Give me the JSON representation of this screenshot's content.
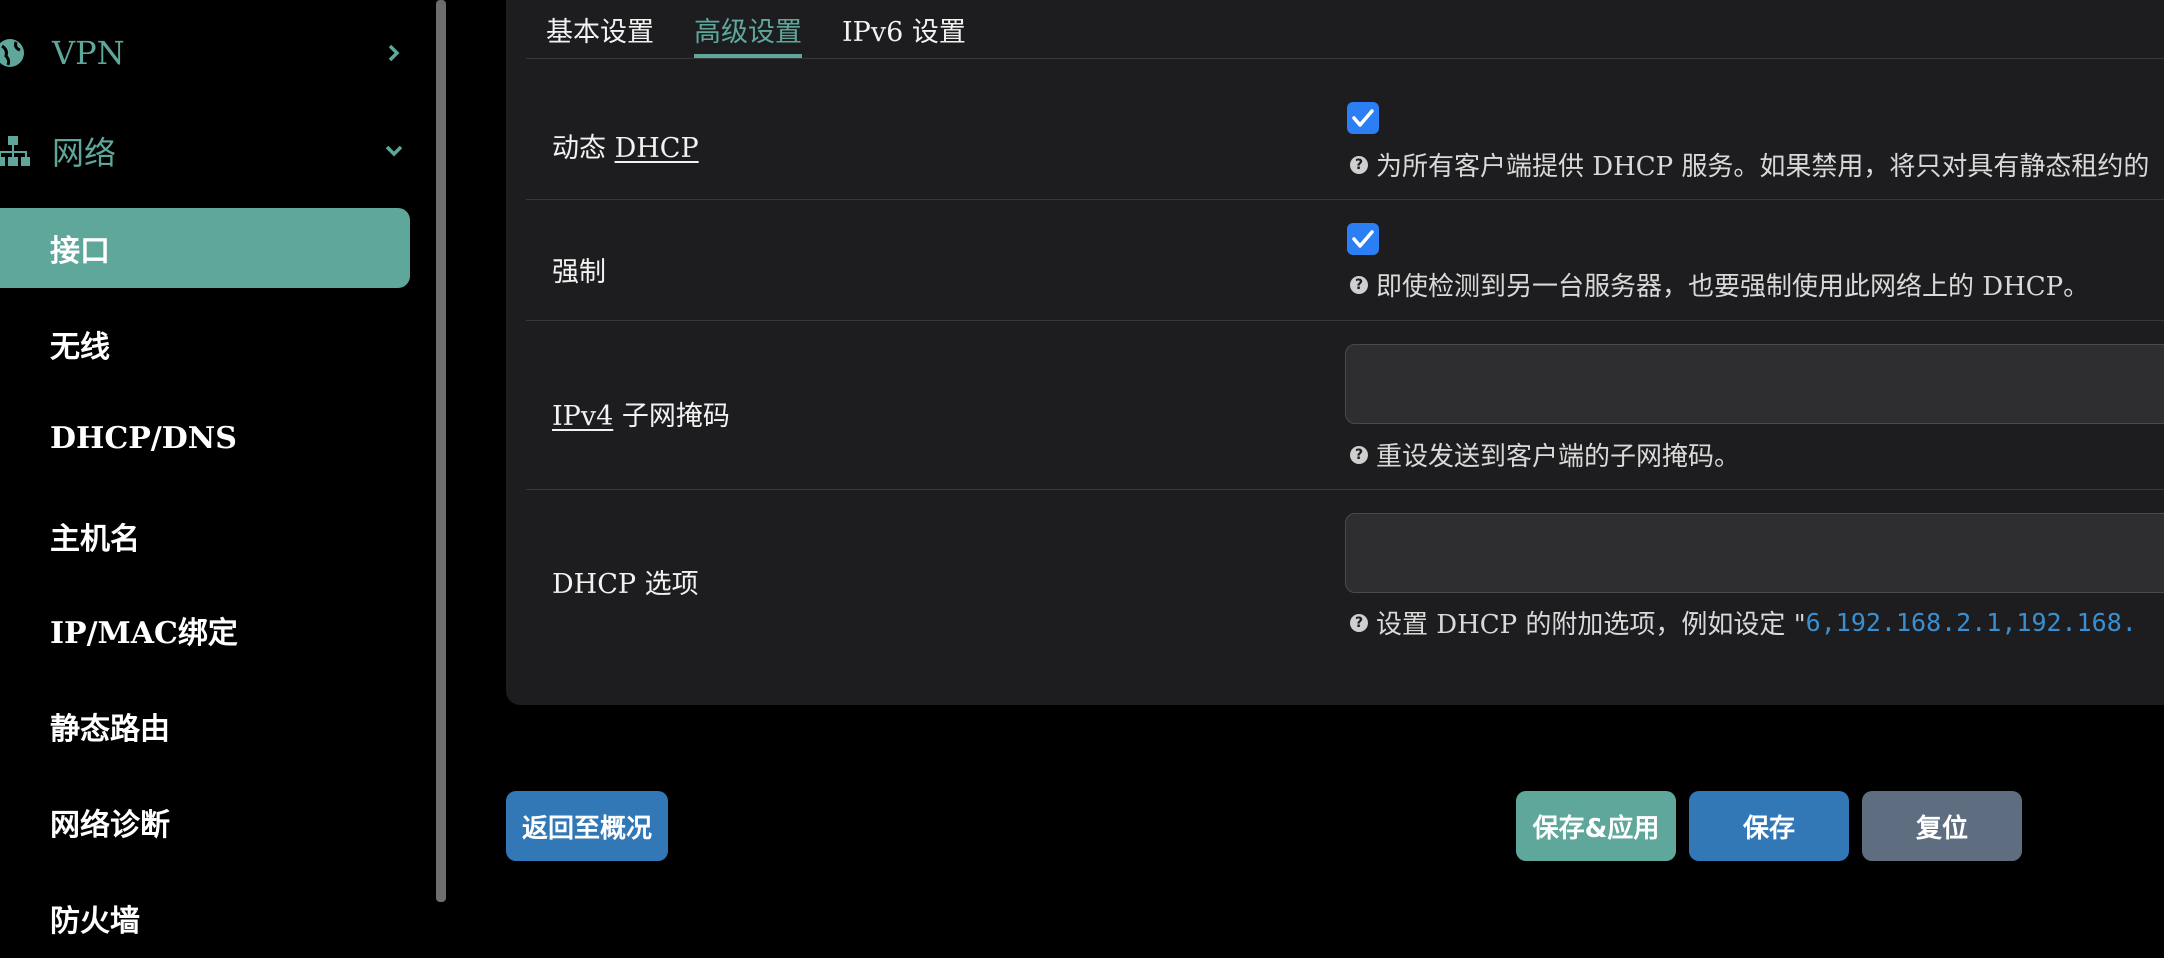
{
  "sidebar": {
    "groups": [
      {
        "label": "VPN",
        "icon": "vpn-globe-icon",
        "expanded": false
      },
      {
        "label": "网络",
        "icon": "network-sitemap-icon",
        "expanded": true
      }
    ],
    "items": [
      {
        "label": "接口",
        "active": true
      },
      {
        "label": "无线"
      },
      {
        "label": "DHCP/DNS"
      },
      {
        "label": "主机名"
      },
      {
        "label": "IP/MAC绑定"
      },
      {
        "label": "静态路由"
      },
      {
        "label": "网络诊断"
      },
      {
        "label": "防火墙"
      }
    ]
  },
  "tabs": [
    {
      "label": "基本设置"
    },
    {
      "label": "高级设置",
      "active": true
    },
    {
      "label": "IPv6 设置"
    }
  ],
  "rows": {
    "dynamic_dhcp": {
      "label_prefix": "动态 ",
      "label_link": "DHCP",
      "checked": true,
      "help": "为所有客户端提供 DHCP 服务。如果禁用，将只对具有静态租约的"
    },
    "force": {
      "label": "强制",
      "checked": true,
      "help": "即使检测到另一台服务器，也要强制使用此网络上的 DHCP。"
    },
    "netmask": {
      "label_link": "IPv4",
      "label_suffix": " 子网掩码",
      "value": "",
      "help": "重设发送到客户端的子网掩码。"
    },
    "dhcp_options": {
      "label": "DHCP 选项",
      "value": "",
      "help_prefix": "设置 DHCP 的附加选项，例如设定 \"",
      "help_code": "6,192.168.2.1,192.168."
    }
  },
  "buttons": {
    "back": "返回至概况",
    "save_apply": "保存&应用",
    "save": "保存",
    "reset": "复位"
  },
  "colors": {
    "accent": "#5fa79b",
    "primary_button": "#3277b6",
    "reset_button": "#5e6e80",
    "checkbox": "#2b7ef3",
    "code": "#3a8fd0"
  }
}
